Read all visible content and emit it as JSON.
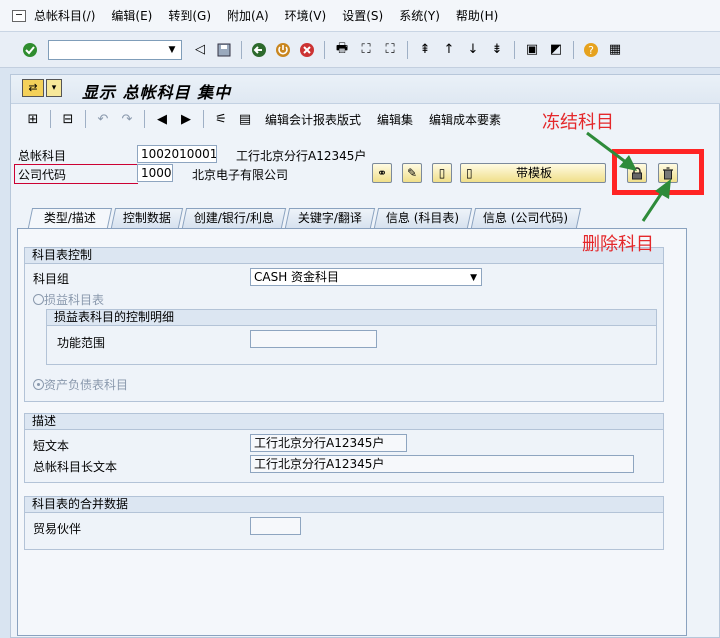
{
  "menubar": {
    "items": [
      "总帐科目(/)",
      "编辑(E)",
      "转到(G)",
      "附加(A)",
      "环境(V)",
      "设置(S)",
      "系统(Y)",
      "帮助(H)"
    ]
  },
  "stdbar": {
    "command_value": ""
  },
  "title": {
    "text": "显示 总帐科目 集中"
  },
  "appbar": {
    "items": [
      "编辑会计报表版式",
      "编辑集",
      "编辑成本要素"
    ]
  },
  "header": {
    "gl_label": "总帐科目",
    "gl_value": "1002010001",
    "gl_desc": "工行北京分行A12345户",
    "cc_label": "公司代码",
    "cc_value": "1000",
    "cc_desc": "北京电子有限公司",
    "template_button": "带模板"
  },
  "tabs": [
    "类型/描述",
    "控制数据",
    "创建/银行/利息",
    "关键字/翻译",
    "信息 (科目表)",
    "信息 (公司代码)"
  ],
  "group_control": {
    "title": "科目表控制",
    "acct_group_label": "科目组",
    "acct_group_value": "CASH 资金科目",
    "pl_radio": "损益科目表",
    "pl_detail_title": "损益表科目的控制明细",
    "func_area_label": "功能范围",
    "func_area_value": "",
    "bs_radio": "资产负债表科目"
  },
  "group_desc": {
    "title": "描述",
    "short_label": "短文本",
    "short_value": "工行北京分行A12345户",
    "long_label": "总帐科目长文本",
    "long_value": "工行北京分行A12345户"
  },
  "group_consol": {
    "title": "科目表的合并数据",
    "partner_label": "贸易伙伴",
    "partner_value": ""
  },
  "annotations": {
    "freeze": "冻结科目",
    "delete": "删除科目",
    "color": "#e4282b",
    "arrow_color": "#2e8b3a"
  }
}
